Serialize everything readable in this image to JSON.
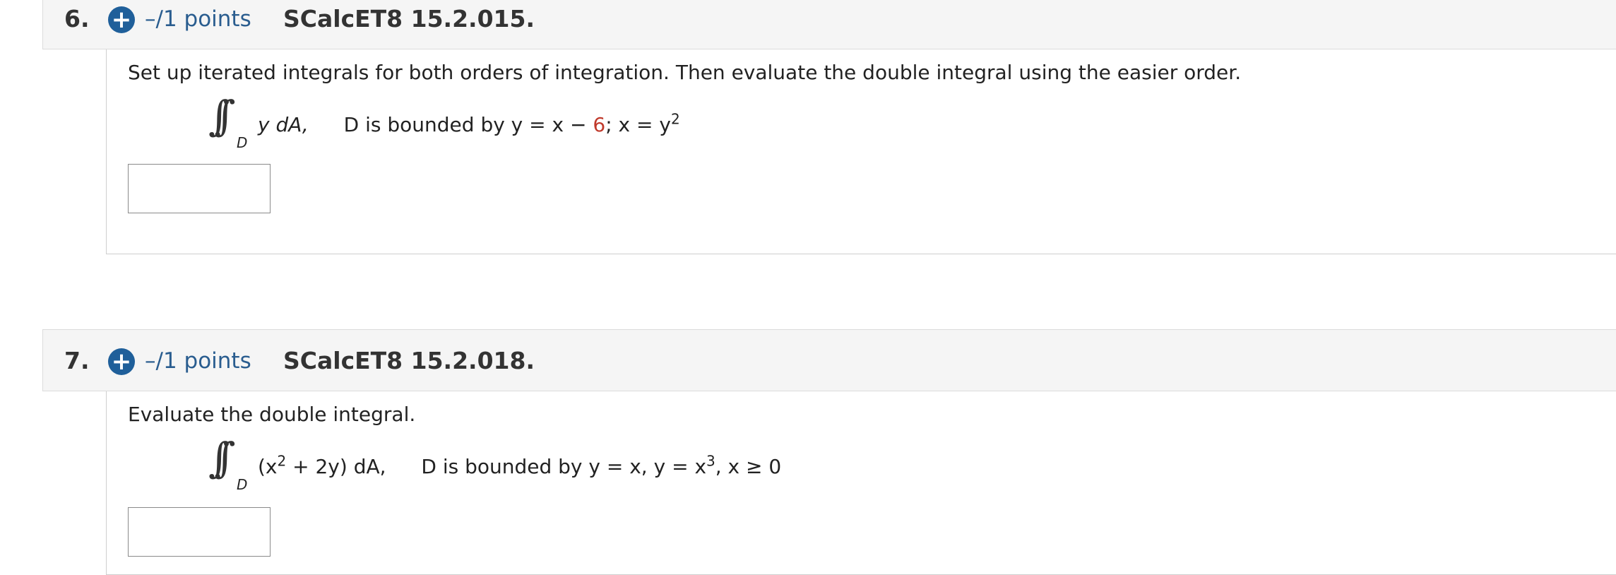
{
  "questions": [
    {
      "number": "6.",
      "points": "–/1 points",
      "id": "SCalcET8 15.2.015.",
      "prompt": "Set up iterated integrals for both orders of integration. Then evaluate the double integral using the easier order.",
      "region_sub": "D",
      "integrand": "y dA,",
      "bound_text_pre": "D is bounded by y = x −",
      "bound_red": "6",
      "bound_text_post": "; x = y",
      "bound_sup": "2"
    },
    {
      "number": "7.",
      "points": "–/1 points",
      "id": "SCalcET8 15.2.018.",
      "prompt": "Evaluate the double integral.",
      "region_sub": "D",
      "integrand_pre": "(x",
      "integrand_sup": "2",
      "integrand_post": " + 2y) dA,",
      "bound_text_pre": "D is bounded by y = x, y = x",
      "bound_sup": "3",
      "bound_text_post": ", x ≥ 0"
    }
  ],
  "icons": {
    "expand": "plus-circle-icon"
  },
  "colors": {
    "accent": "#1f5f9a",
    "points_text": "#2a5d8f",
    "highlight": "#c0392b"
  }
}
